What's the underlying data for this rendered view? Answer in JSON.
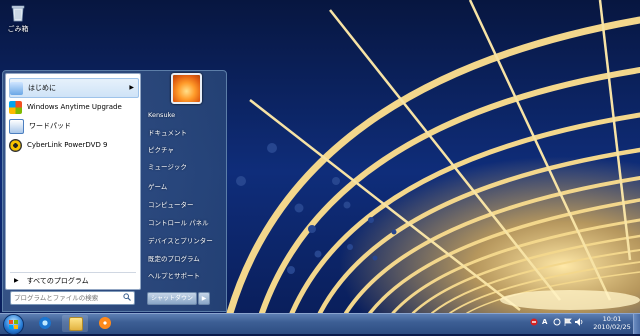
{
  "desktop": {
    "recycle_bin_label": "ごみ箱"
  },
  "start_menu": {
    "programs": [
      {
        "label": "はじめに",
        "icon": "getting-started-icon",
        "has_submenu": true
      },
      {
        "label": "Windows Anytime Upgrade",
        "icon": "windows-upgrade-icon"
      },
      {
        "label": "ワードパッド",
        "icon": "wordpad-icon"
      },
      {
        "label": "CyberLink PowerDVD 9",
        "icon": "powerdvd-icon"
      }
    ],
    "all_programs_label": "すべてのプログラム",
    "search_placeholder": "プログラムとファイルの検索",
    "right_items": [
      "Kensuke",
      "ドキュメント",
      "ピクチャ",
      "ミュージック",
      "ゲーム",
      "コンピューター",
      "コントロール パネル",
      "デバイスとプリンター",
      "既定のプログラム",
      "ヘルプとサポート"
    ],
    "shutdown_label": "シャットダウン"
  },
  "taskbar": {
    "pinned": [
      "internet-explorer-icon",
      "explorer-icon",
      "media-player-icon"
    ],
    "tray_ime": "A",
    "clock_time": "10:01",
    "clock_date": "2010/02/25"
  },
  "colors": {
    "taskbar": "#3d5f95",
    "accent": "#2a7fd8"
  }
}
